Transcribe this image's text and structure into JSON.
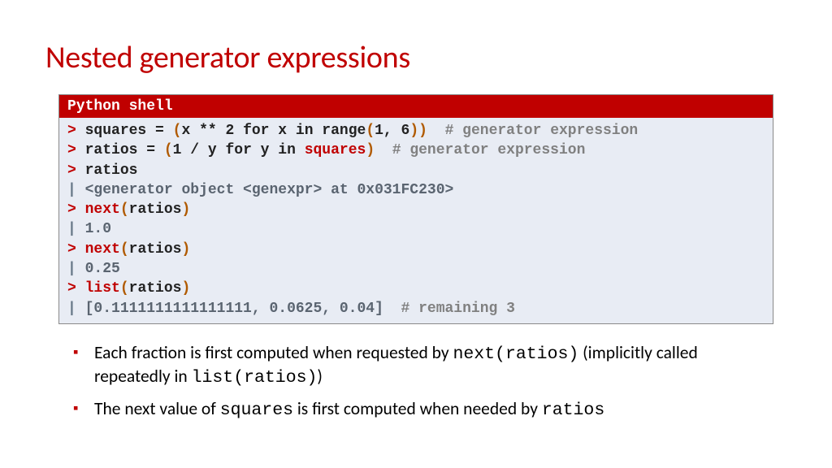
{
  "title": "Nested generator expressions",
  "shell": {
    "header": "Python shell",
    "l1": {
      "prompt": ">",
      "op": "(",
      "code": "squares = ",
      "mid1": "x ** 2 for x in range",
      "mid2": "(",
      "mid3": "1, 6",
      "mid4": ")",
      "cp": ")",
      "cmt": "  # generator expression"
    },
    "l2": {
      "prompt": ">",
      "code": "ratios = ",
      "op": "(",
      "mid": "1 / y for y in ",
      "kw": "squares",
      "cp": ")",
      "cmt": "  # generator expression"
    },
    "l3": {
      "prompt": ">",
      "code": "ratios"
    },
    "l4": {
      "bar": "|",
      "out": "<generator object <genexpr> at 0x031FC230>"
    },
    "l5": {
      "prompt": ">",
      "kw": "next",
      "op": "(",
      "arg": "ratios",
      "cp": ")"
    },
    "l6": {
      "bar": "|",
      "out": "1.0"
    },
    "l7": {
      "prompt": ">",
      "kw": "next",
      "op": "(",
      "arg": "ratios",
      "cp": ")"
    },
    "l8": {
      "bar": "|",
      "out": "0.25"
    },
    "l9": {
      "prompt": ">",
      "kw": "list",
      "op": "(",
      "arg": "ratios",
      "cp": ")"
    },
    "l10": {
      "bar": "|",
      "out": "[0.1111111111111111, 0.0625, 0.04]",
      "cmt": "  # remaining 3"
    }
  },
  "bullets": {
    "b1a": "Each fraction is first computed when requested by ",
    "b1m1": "next(ratios)",
    "b1b": " (implicitly called repeatedly in ",
    "b1m2": "list(ratios)",
    "b1c": ")",
    "b2a": "The next value of ",
    "b2m1": "squares",
    "b2b": " is first computed when needed by ",
    "b2m2": "ratios"
  }
}
